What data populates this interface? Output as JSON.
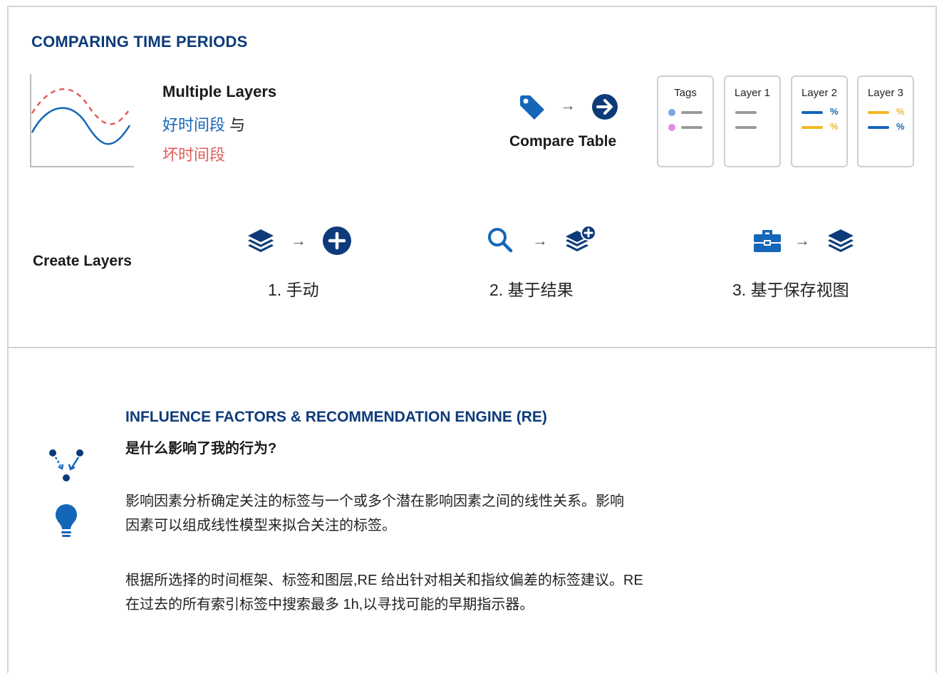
{
  "section1": {
    "title": "COMPARING TIME PERIODS",
    "multiple_layers": {
      "title": "Multiple Layers",
      "good": "好时间段",
      "with": "与",
      "bad": "坏时间段"
    },
    "compare": {
      "label": "Compare Table",
      "arrow": "→",
      "left_icon": "tag-icon",
      "right_icon": "arrow-circle-right-icon"
    },
    "cards": [
      {
        "header": "Tags",
        "rows": [
          {
            "dot": "#7aa7e8",
            "bar": "#9a9a9a"
          },
          {
            "dot": "#e68ae8",
            "bar": "#9a9a9a"
          }
        ]
      },
      {
        "header": "Layer 1",
        "rows": [
          {
            "bar": "#9a9a9a"
          },
          {
            "bar": "#9a9a9a"
          }
        ]
      },
      {
        "header": "Layer 2",
        "rows": [
          {
            "bar": "#1466b8",
            "pct": "%",
            "pct_color": "#1466b8"
          },
          {
            "bar": "#f2b824",
            "pct": "%",
            "pct_color": "#f2b824"
          }
        ]
      },
      {
        "header": "Layer 3",
        "rows": [
          {
            "bar": "#f2b824",
            "pct": "%",
            "pct_color": "#f2b824"
          },
          {
            "bar": "#1466b8",
            "pct": "%",
            "pct_color": "#1466b8"
          }
        ]
      }
    ]
  },
  "create_layers": {
    "label": "Create Layers",
    "arrow": "→",
    "steps": [
      {
        "text": "1.  手动",
        "icon_a": "layers-icon",
        "icon_b": "plus-circle-icon"
      },
      {
        "text": "2.  基于结果",
        "icon_a": "search-icon",
        "icon_b": "layers-plus-icon"
      },
      {
        "text": "3.  基于保存视图",
        "icon_a": "toolbox-icon",
        "icon_b": "layers-icon"
      }
    ]
  },
  "section2": {
    "title": "INFLUENCE FACTORS & RECOMMENDATION ENGINE (RE)",
    "subtitle": "是什么影响了我的行为?",
    "para1_line1": "影响因素分析确定关注的标签与一个或多个潜在影响因素之间的线性关系。影响",
    "para1_line2": "因素可以组成线性模型来拟合关注的标签。",
    "para2_line1": "根据所选择的时间框架、标签和图层,RE 给出针对相关和指纹偏差的标签建议。RE",
    "para2_line2": "在过去的所有索引标签中搜索最多 1h,以寻找可能的早期指示器。",
    "icons": [
      "influence-graph-icon",
      "lightbulb-icon"
    ]
  },
  "colors": {
    "brand_dark": "#0d3b7a",
    "brand": "#1466b8",
    "bad": "#e25b5b",
    "yellow": "#f2b824",
    "gray": "#9a9a9a",
    "border": "#d4d4d4"
  }
}
